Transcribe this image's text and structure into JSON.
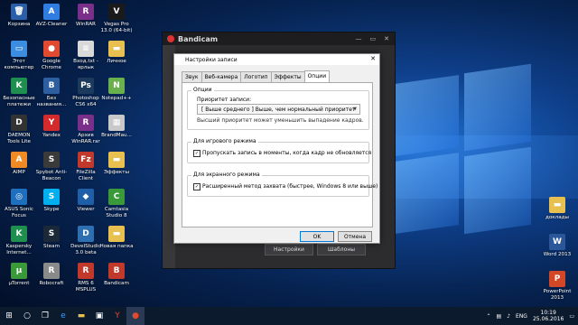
{
  "desktop": {
    "icons": [
      {
        "label": "Корзина",
        "glyph": "🗑",
        "color": "#2a5fa8"
      },
      {
        "label": "AVZ-Cleaner",
        "glyph": "A",
        "color": "#2f7de0"
      },
      {
        "label": "WinRAR",
        "glyph": "R",
        "color": "#7a2f8a"
      },
      {
        "label": "Vegas Pro 13.0 (64-bit)",
        "glyph": "V",
        "color": "#1a1a1a"
      },
      {
        "label": "Этот компьютер",
        "glyph": "▭",
        "color": "#3c8de0"
      },
      {
        "label": "Google Chrome",
        "glyph": "●",
        "color": "#e04a2f"
      },
      {
        "label": "Вход.txt - ярлык",
        "glyph": "≡",
        "color": "#d9d9d9"
      },
      {
        "label": "Личное",
        "glyph": "▬",
        "color": "#e8c050"
      },
      {
        "label": "Безопасные платежи",
        "glyph": "K",
        "color": "#1e8f4e"
      },
      {
        "label": "Без названия...",
        "glyph": "B",
        "color": "#2d5fa0"
      },
      {
        "label": "Photoshop CS6 x64",
        "glyph": "Ps",
        "color": "#1b3a5c"
      },
      {
        "label": "Notepad++",
        "glyph": "N",
        "color": "#6ab04c"
      },
      {
        "label": "DAEMON Tools Lite",
        "glyph": "D",
        "color": "#333"
      },
      {
        "label": "Yandex",
        "glyph": "Y",
        "color": "#d32b2b"
      },
      {
        "label": "Архив WinRAR.rar",
        "glyph": "R",
        "color": "#7a2f8a"
      },
      {
        "label": "BrandMau...",
        "glyph": "▦",
        "color": "#c8c8c8"
      },
      {
        "label": "AIMP",
        "glyph": "A",
        "color": "#f08a24"
      },
      {
        "label": "Spybot Anti-Beacon",
        "glyph": "S",
        "color": "#3a3a3a"
      },
      {
        "label": "FileZilla Client",
        "glyph": "Fz",
        "color": "#c0392b"
      },
      {
        "label": "Эффекты",
        "glyph": "▬",
        "color": "#e8c050"
      },
      {
        "label": "ASUS Sonic Focus",
        "glyph": "◎",
        "color": "#1f6fbf"
      },
      {
        "label": "Skype",
        "glyph": "S",
        "color": "#00aff0"
      },
      {
        "label": "Viewer",
        "glyph": "◆",
        "color": "#1e5fa8"
      },
      {
        "label": "Camtasia Studio 8",
        "glyph": "C",
        "color": "#3a9a3a"
      },
      {
        "label": "Kaspersky Internet...",
        "glyph": "K",
        "color": "#1e8f4e"
      },
      {
        "label": "Steam",
        "glyph": "S",
        "color": "#1b2838"
      },
      {
        "label": "DevelStudio 3.0 beta",
        "glyph": "D",
        "color": "#2d6fb0"
      },
      {
        "label": "Новая папка",
        "glyph": "▬",
        "color": "#e8c050"
      },
      {
        "label": "µTorrent",
        "glyph": "µ",
        "color": "#3a9a3a"
      },
      {
        "label": "Robocraft",
        "glyph": "R",
        "color": "#8a8a8a"
      },
      {
        "label": "RMS 6 MSPLUS",
        "glyph": "R",
        "color": "#c0392b"
      },
      {
        "label": "Bandicam",
        "glyph": "B",
        "color": "#c0392b"
      }
    ],
    "right_icons": [
      {
        "label": "доклады",
        "glyph": "▬",
        "color": "#e8c050"
      },
      {
        "label": "Word 2013",
        "glyph": "W",
        "color": "#2b579a"
      },
      {
        "label": "PowerPoint 2013",
        "glyph": "P",
        "color": "#d24726"
      }
    ]
  },
  "bandicam": {
    "title": "Bandicam",
    "window_controls": [
      "—",
      "▭",
      "✕"
    ],
    "settings_label": "Настройки",
    "templates_label": "Шаблоны"
  },
  "dialog": {
    "title": "Настройки записи",
    "close": "✕",
    "tabs": [
      "Звук",
      "Веб-камера",
      "Логотип",
      "Эффекты",
      "Опции"
    ],
    "active_tab": "Опции",
    "options_group": "Опции",
    "priority_label": "Приоритет записи:",
    "priority_value": "[ Выше среднего ]    Выше, чем нормальный приоритет",
    "priority_hint": "Высший приоритет может уменьшить выпадение кадров.",
    "game_group": "Для игрового режима",
    "game_checkbox": "Пропускать запись в моменты, когда кадр не обновляется",
    "screen_group": "Для экранного режима",
    "screen_checkbox": "Расширенный метод захвата (быстрее, Windows 8 или выше)",
    "ok": "OK",
    "cancel": "Отмена"
  },
  "taskbar": {
    "lang": "ENG",
    "time": "10:19",
    "date": "25.06.2016"
  }
}
